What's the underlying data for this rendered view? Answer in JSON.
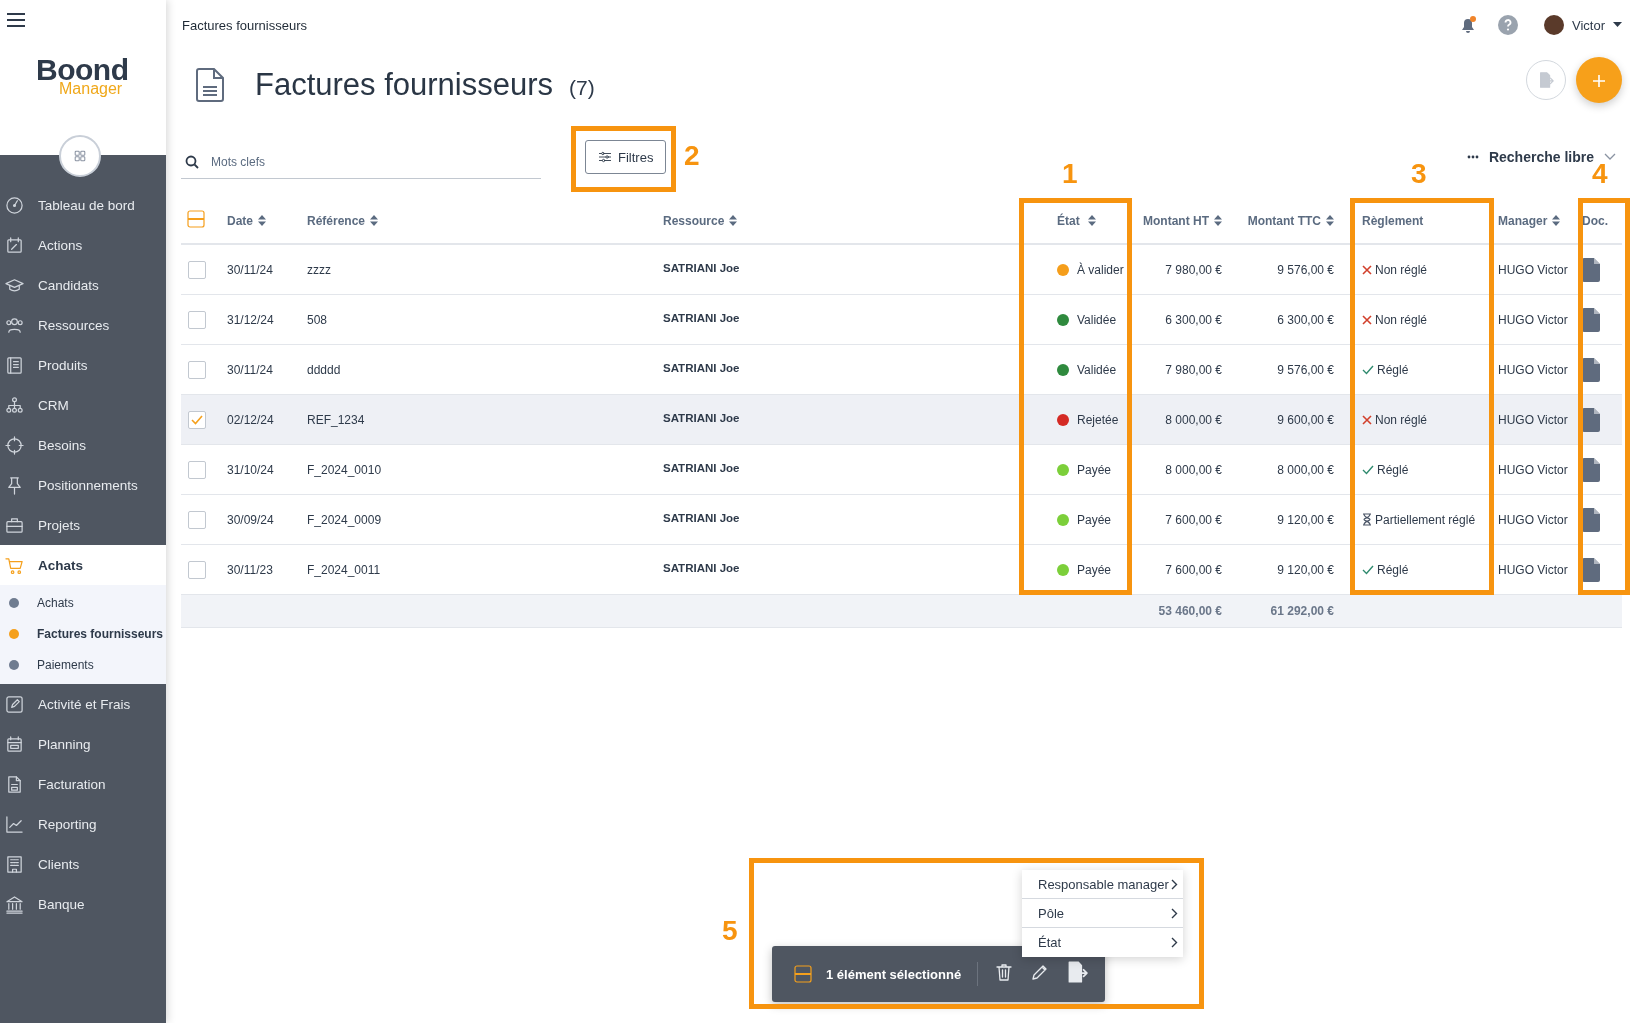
{
  "sidebar": {
    "logo": {
      "name": "Boond",
      "sub": "Manager"
    },
    "items": [
      {
        "label": "Tableau de bord",
        "selected": false
      },
      {
        "label": "Actions",
        "selected": false
      },
      {
        "label": "Candidats",
        "selected": false
      },
      {
        "label": "Ressources",
        "selected": false
      },
      {
        "label": "Produits",
        "selected": false
      },
      {
        "label": "CRM",
        "selected": false
      },
      {
        "label": "Besoins",
        "selected": false
      },
      {
        "label": "Positionnements",
        "selected": false
      },
      {
        "label": "Projets",
        "selected": false
      },
      {
        "label": "Achats",
        "selected": true,
        "children": [
          {
            "label": "Achats",
            "selected": false
          },
          {
            "label": "Factures fournisseurs",
            "selected": true
          },
          {
            "label": "Paiements",
            "selected": false
          }
        ]
      },
      {
        "label": "Activité et Frais",
        "selected": false
      },
      {
        "label": "Planning",
        "selected": false
      },
      {
        "label": "Facturation",
        "selected": false
      },
      {
        "label": "Reporting",
        "selected": false
      },
      {
        "label": "Clients",
        "selected": false
      },
      {
        "label": "Banque",
        "selected": false
      }
    ]
  },
  "topbar": {
    "breadcrumb": "Factures fournisseurs",
    "notification": true,
    "user": "Victor"
  },
  "page": {
    "title": "Factures fournisseurs",
    "count": "(7)"
  },
  "search": {
    "placeholder": "Mots clefs"
  },
  "filter_button": "Filtres",
  "free_search": "Recherche libre",
  "table": {
    "select_all_partial": true,
    "columns": [
      "Date",
      "Référence",
      "Ressource",
      "État",
      "Montant HT",
      "Montant TTC",
      "Règlement",
      "Manager",
      "Doc."
    ],
    "sortable": [
      true,
      true,
      true,
      true,
      true,
      true,
      false,
      true,
      false
    ],
    "rows": [
      {
        "selected": false,
        "date": "30/11/24",
        "reference": "zzzz",
        "resource": "SATRIANI Joe",
        "status": {
          "label": "À valider",
          "color": "#f59e1b"
        },
        "ht": "7 980,00 €",
        "ttc": "9 576,00 €",
        "payment": {
          "kind": "unpaid",
          "label": "Non réglé"
        },
        "manager": "HUGO Victor"
      },
      {
        "selected": false,
        "date": "31/12/24",
        "reference": "508",
        "resource": "SATRIANI Joe",
        "status": {
          "label": "Validée",
          "color": "#2f8a3e"
        },
        "ht": "6 300,00 €",
        "ttc": "6 300,00 €",
        "payment": {
          "kind": "unpaid",
          "label": "Non réglé"
        },
        "manager": "HUGO Victor"
      },
      {
        "selected": false,
        "date": "30/11/24",
        "reference": "ddddd",
        "resource": "SATRIANI Joe",
        "status": {
          "label": "Validée",
          "color": "#2f8a3e"
        },
        "ht": "7 980,00 €",
        "ttc": "9 576,00 €",
        "payment": {
          "kind": "paid",
          "label": "Réglé"
        },
        "manager": "HUGO Victor"
      },
      {
        "selected": true,
        "date": "02/12/24",
        "reference": "REF_1234",
        "resource": "SATRIANI Joe",
        "status": {
          "label": "Rejetée",
          "color": "#d42a24"
        },
        "ht": "8 000,00 €",
        "ttc": "9 600,00 €",
        "payment": {
          "kind": "unpaid",
          "label": "Non réglé"
        },
        "manager": "HUGO Victor"
      },
      {
        "selected": false,
        "date": "31/10/24",
        "reference": "F_2024_0010",
        "resource": "SATRIANI Joe",
        "status": {
          "label": "Payée",
          "color": "#7ccf3a"
        },
        "ht": "8 000,00 €",
        "ttc": "8 000,00 €",
        "payment": {
          "kind": "paid",
          "label": "Réglé"
        },
        "manager": "HUGO Victor"
      },
      {
        "selected": false,
        "date": "30/09/24",
        "reference": "F_2024_0009",
        "resource": "SATRIANI Joe",
        "status": {
          "label": "Payée",
          "color": "#7ccf3a"
        },
        "ht": "7 600,00 €",
        "ttc": "9 120,00 €",
        "payment": {
          "kind": "partial",
          "label": "Partiellement réglé"
        },
        "manager": "HUGO Victor"
      },
      {
        "selected": false,
        "date": "30/11/23",
        "reference": "F_2024_0011",
        "resource": "SATRIANI Joe",
        "status": {
          "label": "Payée",
          "color": "#7ccf3a"
        },
        "ht": "7 600,00 €",
        "ttc": "9 120,00 €",
        "payment": {
          "kind": "paid",
          "label": "Réglé"
        },
        "manager": "HUGO Victor"
      }
    ],
    "totals": {
      "ht": "53 460,00 €",
      "ttc": "61 292,00 €"
    }
  },
  "bulk_bar": {
    "label": "1 élément sélectionné",
    "partial": true
  },
  "context_menu": [
    "Responsable manager",
    "Pôle",
    "État"
  ],
  "annotations": [
    {
      "label": "1"
    },
    {
      "label": "2"
    },
    {
      "label": "3"
    },
    {
      "label": "4"
    },
    {
      "label": "5"
    }
  ]
}
